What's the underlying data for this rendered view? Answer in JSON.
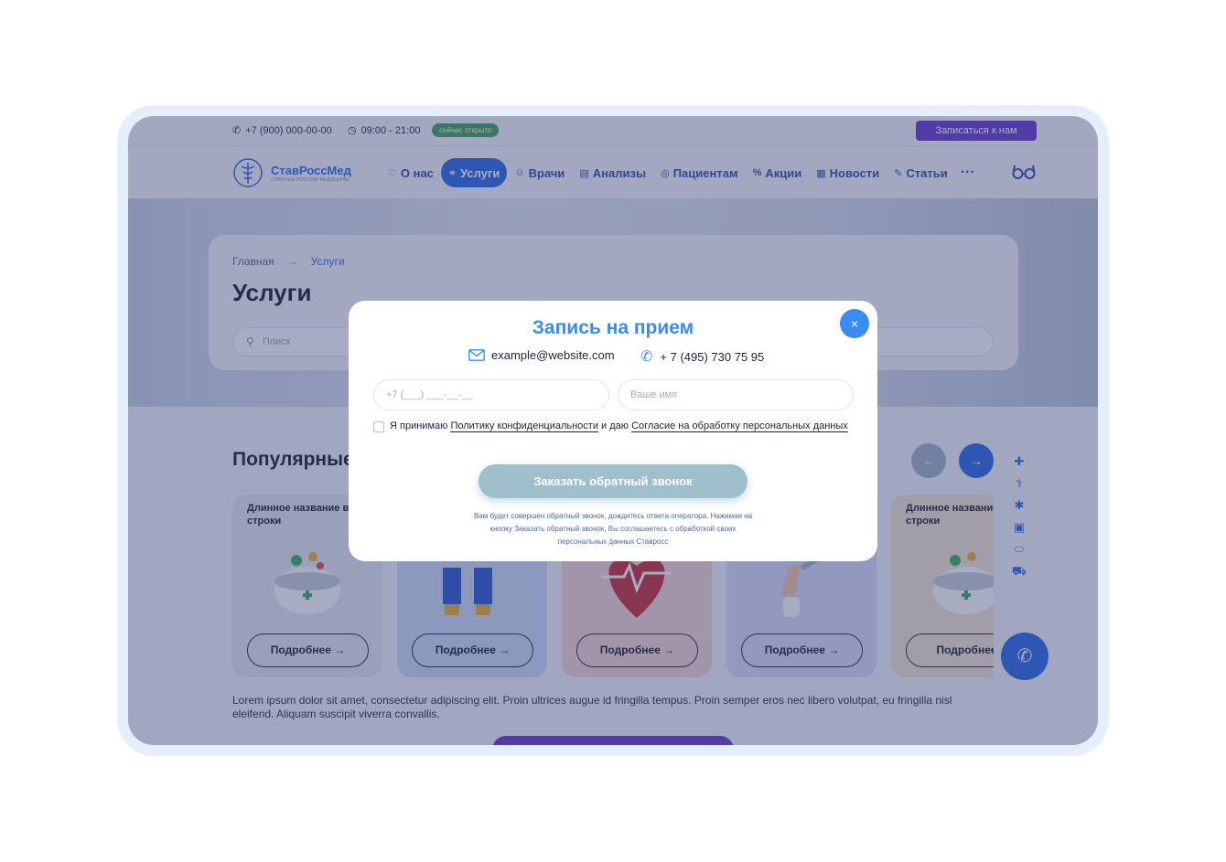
{
  "topbar": {
    "phone": "+7 (900) 000-00-00",
    "hours": "09:00 - 21:00",
    "status_badge": "сейчас открыто",
    "cta": "Записаться к нам"
  },
  "logo": {
    "name": "СтавРоссМед",
    "tagline": "СЛАВНЫЕ РОССИИ МЕДИЦИНЫ"
  },
  "nav": {
    "items": [
      {
        "label": "О нас",
        "icon": "heart-icon"
      },
      {
        "label": "Услуги",
        "icon": "pills-icon"
      },
      {
        "label": "Врачи",
        "icon": "doctor-icon"
      },
      {
        "label": "Анализы",
        "icon": "clipboard-icon"
      },
      {
        "label": "Пациентам",
        "icon": "user-icon"
      },
      {
        "label": "Акции",
        "icon": "percent-icon"
      },
      {
        "label": "Новости",
        "icon": "newspaper-icon"
      },
      {
        "label": "Статьи",
        "icon": "article-icon"
      }
    ],
    "more": "···"
  },
  "hero": {
    "breadcrumb": {
      "home": "Главная",
      "sep": "→",
      "current": "Услуги"
    },
    "title": "Услуги",
    "search_placeholder": "Поиск"
  },
  "popular": {
    "title": "Популярные",
    "prev": "←",
    "next": "→",
    "cards": [
      {
        "title": "Длинное название в две строки",
        "button": "Подробнее →",
        "color": "#e4ebf1",
        "art": "mortar-icon"
      },
      {
        "title": "",
        "button": "Подробнее →",
        "color": "#cfdcf7",
        "art": "gloves-icon"
      },
      {
        "title": "",
        "button": "Подробнее →",
        "color": "#f6d7d5",
        "art": "heart-pulse-icon"
      },
      {
        "title": "",
        "button": "Подробнее →",
        "color": "#dbdcf8",
        "art": "vaccine-icon"
      },
      {
        "title": "Длинное название в две строки",
        "button": "Подробнее",
        "color": "#f5e7d4",
        "art": "mortar-icon"
      }
    ]
  },
  "lorem": "Lorem ipsum dolor sit amet, consectetur adipiscing elit. Proin ultrices augue id fringilla tempus. Proin semper eros nec libero volutpat, eu fringilla nisl eleifend. Aliquam suscipit viverra convallis.",
  "side_widget": [
    "medical-kit-icon",
    "stethoscope-icon",
    "asterisk-icon",
    "medical-card-icon",
    "pill-icon",
    "ambulance-icon"
  ],
  "modal": {
    "title": "Запись на прием",
    "close": "×",
    "email": "example@website.com",
    "phone": "+ 7 (495) 730 75 95",
    "phone_placeholder": "+7 (___) ___-__-__",
    "name_placeholder": "Ваше имя",
    "consent_prefix": "Я принимаю ",
    "consent_link1": "Политику конфиденциальности",
    "consent_mid": " и даю ",
    "consent_link2": "Согласие на обработку персональных данных",
    "submit": "Заказать обратный звонок",
    "note": "Вам будет совершен обратный звонок, дождитесь ответа оператора. Нажимая на кнопку Заказать обратный звонок, Вы соглашаетесь с обработкой своих персональных данных Ставросс"
  }
}
